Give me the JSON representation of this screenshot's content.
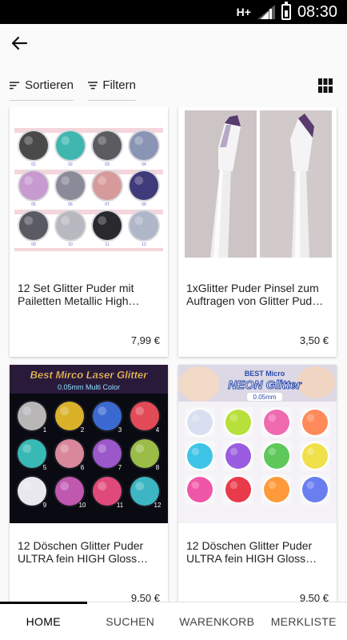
{
  "status_bar": {
    "network": "H+",
    "time": "08:30"
  },
  "app_bar": {
    "back_icon": "arrow-left-icon"
  },
  "toolbar": {
    "sort_label": "Sortieren",
    "filter_label": "Filtern",
    "sort_icon": "sort-lines-icon",
    "filter_icon": "filter-lines-icon",
    "view_toggle_icon": "grid-view-icon"
  },
  "products": [
    {
      "title": "12 Set Glitter Puder mit Pailetten Metallic High…",
      "price": "7,99 €",
      "image": "glitter-jars-grid-image",
      "jar_labels": [
        "01",
        "02",
        "03",
        "04",
        "05",
        "06",
        "07",
        "08",
        "09",
        "10",
        "11",
        "12"
      ]
    },
    {
      "title": "1xGlitter Puder Pinsel zum Auftragen von Glitter Pud…",
      "price": "3,50 €",
      "image": "brush-pair-image"
    },
    {
      "title": "12 Döschen Glitter Puder ULTRA fein HIGH Gloss…",
      "price": "9,50 €",
      "image": "micro-laser-glitter-image",
      "banner": "Best Mirco Laser Glitter",
      "sub_banner": "0.05mm Multi Color",
      "jar_labels": [
        "1",
        "2",
        "3",
        "4",
        "5",
        "6",
        "7",
        "8",
        "9",
        "10",
        "11",
        "12"
      ]
    },
    {
      "title": "12 Döschen Glitter Puder ULTRA fein HIGH Gloss…",
      "price": "9,50 €",
      "image": "neon-glitter-image",
      "banner_top": "BEST Micro",
      "banner": "NEON Glitter",
      "sub_banner": "0.05mm"
    }
  ],
  "colors": {
    "set1": [
      "#4a4a4a",
      "#3fb7b0",
      "#5b5b60",
      "#8a94b5",
      "#c79ad0",
      "#8a8a98",
      "#d69a9a",
      "#3f3a7a",
      "#5a5a62",
      "#b8b8c0",
      "#2a2a2e",
      "#aeb6c8"
    ],
    "set3": [
      "#b9b6b8",
      "#d9b22a",
      "#3a6ad1",
      "#e24a58",
      "#38b9b5",
      "#d9889b",
      "#9b58c9",
      "#9bbd48",
      "#e8e8ee",
      "#c058b0",
      "#e04a7a",
      "#3bb6c2"
    ],
    "set4": [
      "#d8dff0",
      "#b8e03a",
      "#f06ab0",
      "#ff8a5a",
      "#3ec4e6",
      "#9a5ce0",
      "#5ec85a",
      "#f0e04a",
      "#f056a8",
      "#e83a4a",
      "#ff9a3a",
      "#6a7ef0"
    ]
  },
  "bottom_nav": [
    {
      "label": "HOME",
      "active": true
    },
    {
      "label": "SUCHEN",
      "active": false
    },
    {
      "label": "WARENKORB",
      "active": false
    },
    {
      "label": "MERKLISTE",
      "active": false
    }
  ]
}
